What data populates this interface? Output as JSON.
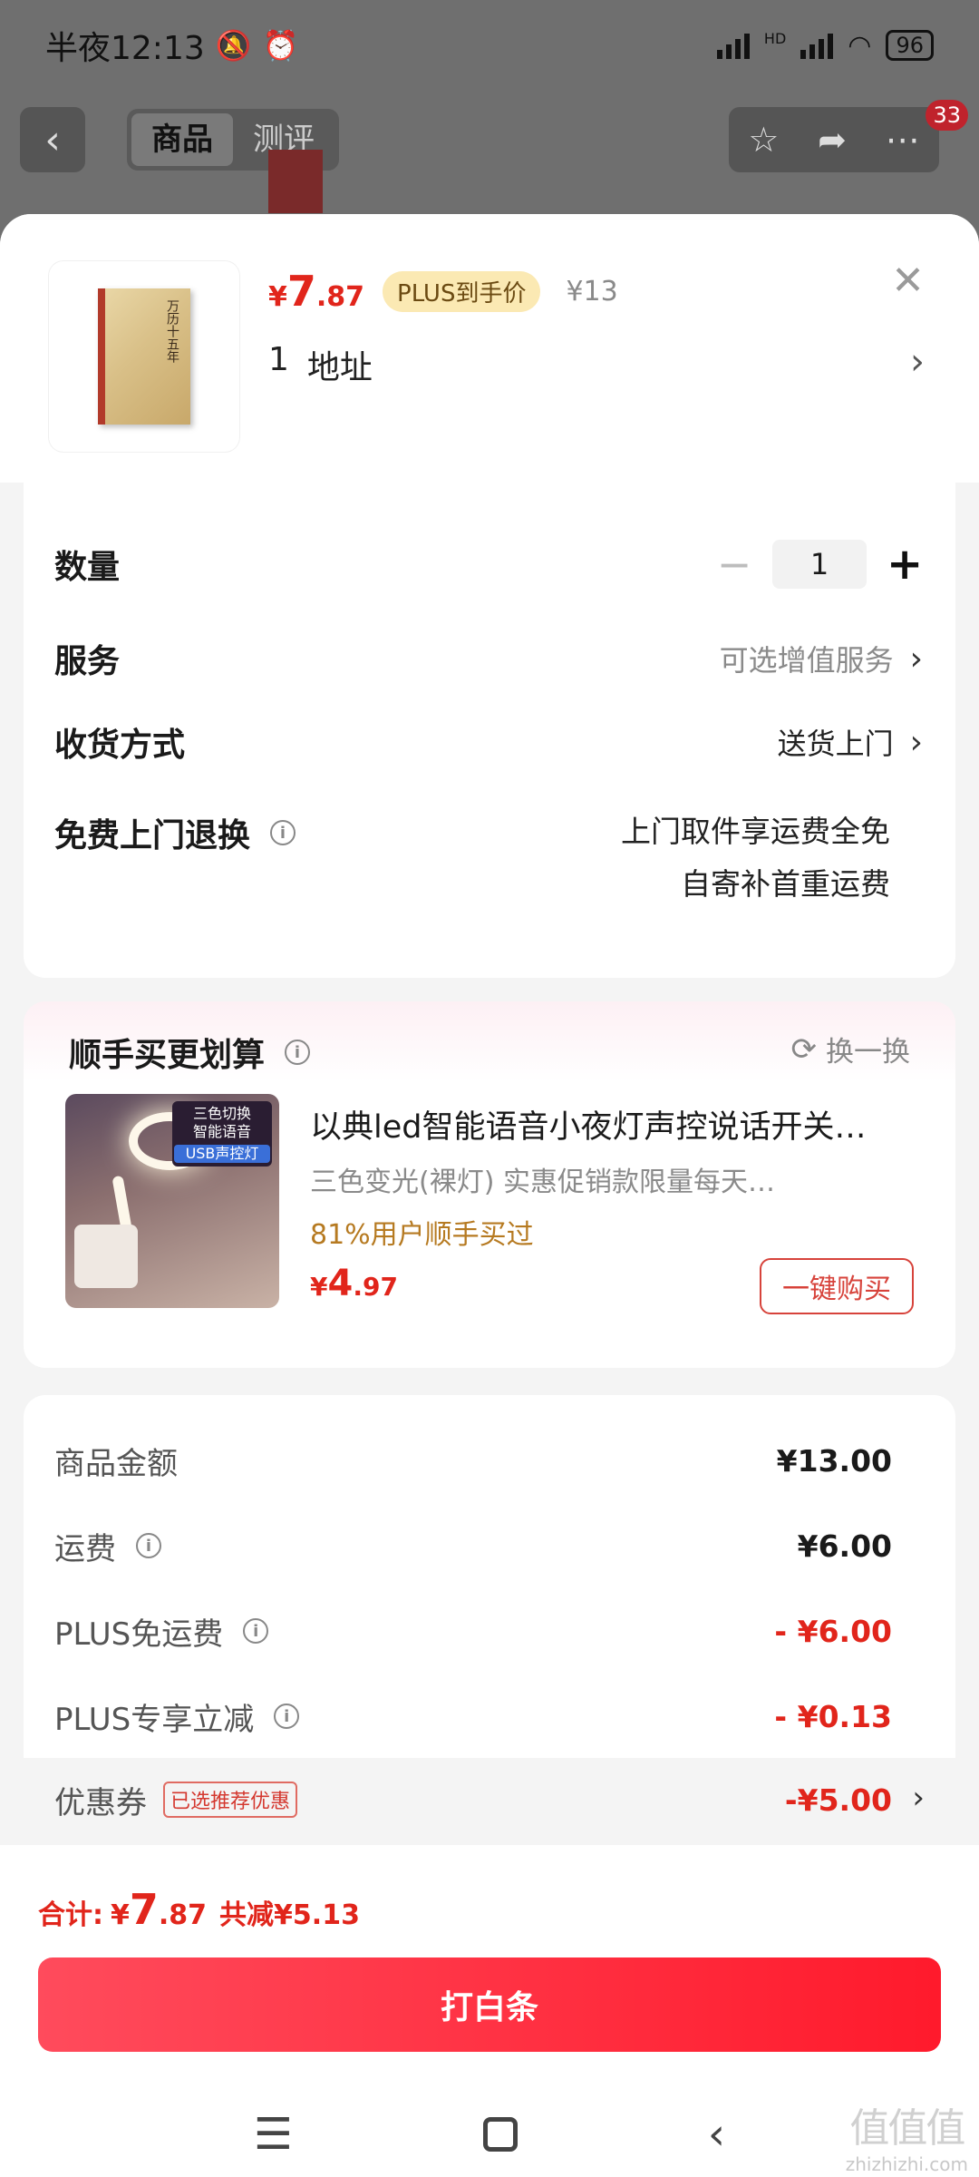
{
  "status_bar": {
    "time": "半夜12:13",
    "battery": "96",
    "network": "HD"
  },
  "top_nav": {
    "tabs": [
      {
        "label": "商品"
      },
      {
        "label": "测评"
      }
    ],
    "badge": "33"
  },
  "product": {
    "price_symbol": "¥",
    "price_int": "7",
    "price_dec": ".87",
    "plus_tag": "PLUS到手价",
    "original_price": "¥13",
    "address_count": "1",
    "address_label": "地址",
    "book_title": "万历十五年"
  },
  "attributes": {
    "quantity_label": "数量",
    "quantity_value": "1",
    "service_label": "服务",
    "service_value": "可选增值服务",
    "delivery_label": "收货方式",
    "delivery_value": "送货上门",
    "return_label": "免费上门退换",
    "return_line1": "上门取件享运费全免",
    "return_line2": "自寄补首重运费"
  },
  "upsell": {
    "title": "顺手买更划算",
    "refresh": "换一换",
    "name": "以典led智能语音小夜灯声控说话开关…",
    "spec": "三色变光(裸灯)   实惠促销款限量每天…",
    "bought": "81%用户顺手买过",
    "price_symbol": "¥",
    "price_int": "4",
    "price_dec": ".97",
    "buy_label": "一键购买",
    "image_badge": [
      "三色切换",
      "智能语音",
      "USB声控灯"
    ]
  },
  "summary": {
    "rows": [
      {
        "label": "商品金额",
        "value": "¥13.00"
      },
      {
        "label": "运费",
        "value": "¥6.00"
      },
      {
        "label": "PLUS免运费",
        "value": "- ¥6.00"
      },
      {
        "label": "PLUS专享立减",
        "value": "- ¥0.13"
      },
      {
        "label": "优惠券",
        "value": "-¥5.00",
        "tag": "已选推荐优惠"
      }
    ]
  },
  "bottom": {
    "total_label": "合计:",
    "total_symbol": "¥",
    "total_int": "7",
    "total_dec": ".87",
    "total_save": "共减¥5.13",
    "pay_label": "打白条"
  },
  "watermark": {
    "big": "值值值",
    "small": "zhizhizhi.com"
  },
  "colors": {
    "accent_red": "#e1251b",
    "pay_button": "#ff2a3b",
    "plus_gold": "#fbe9b3"
  }
}
